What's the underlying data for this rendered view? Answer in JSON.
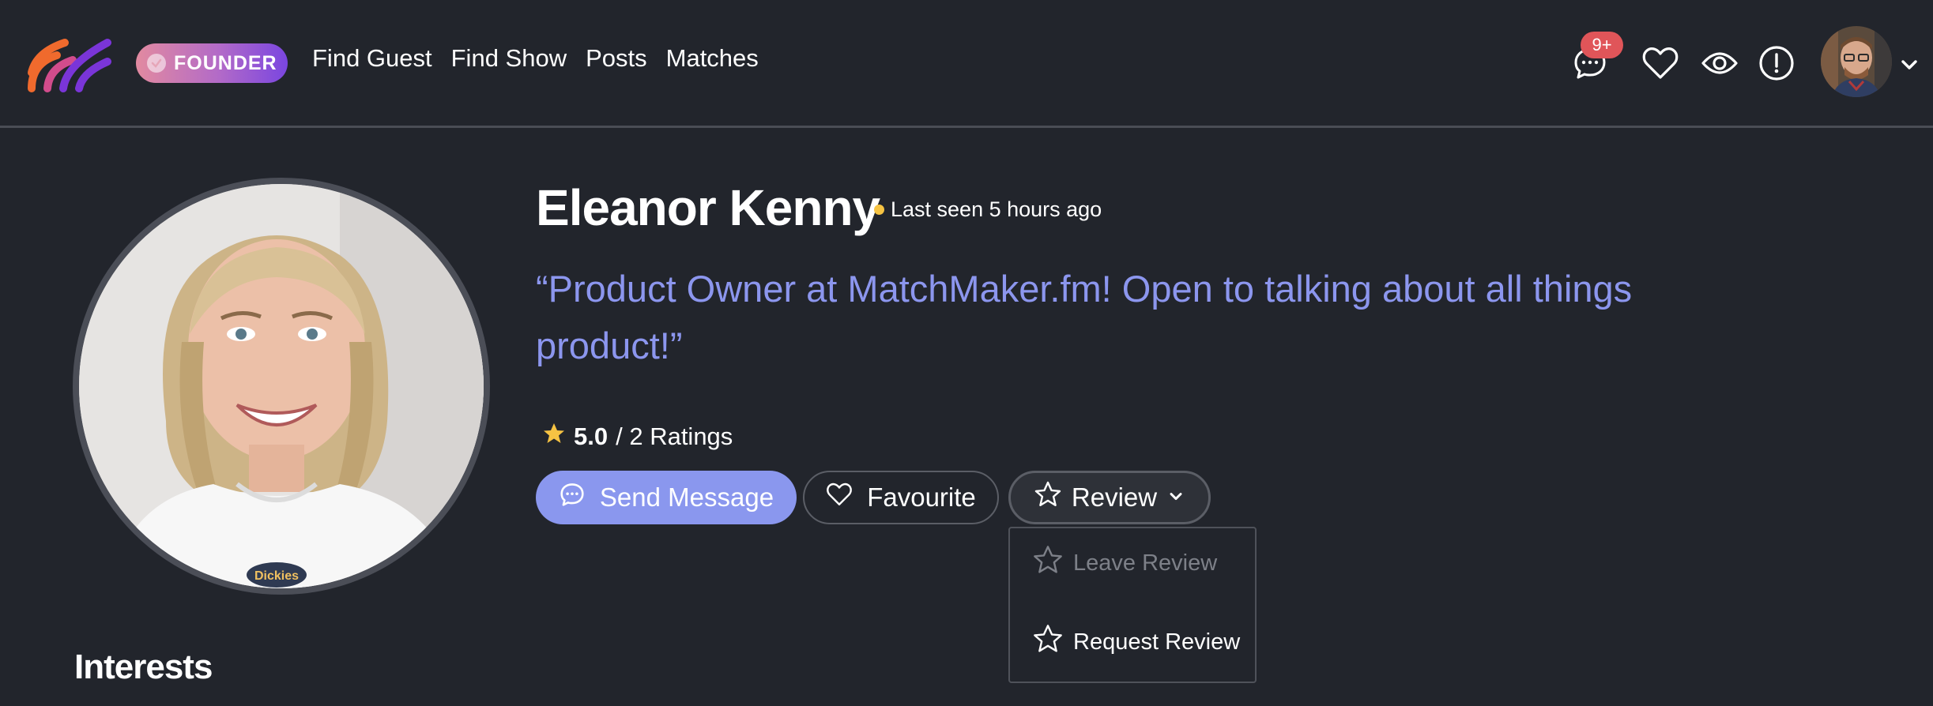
{
  "nav": {
    "badge_label": "FOUNDER",
    "links": [
      "Find Guest",
      "Find Show",
      "Posts",
      "Matches"
    ],
    "notification_count": "9+"
  },
  "profile": {
    "name": "Eleanor Kenny",
    "last_seen": "Last seen 5 hours ago",
    "headline": "“Product Owner at MatchMaker.fm! Open to talking about all things product!”",
    "rating_score": "5.0",
    "rating_count": "/ 2 Ratings",
    "photo_badge_text": "Dickies"
  },
  "actions": {
    "send_message": "Send Message",
    "favourite": "Favourite",
    "review": "Review"
  },
  "review_menu": {
    "items": [
      "Leave Review",
      "Request Review"
    ]
  },
  "sections": {
    "interests_heading": "Interests"
  },
  "colors": {
    "background": "#22252c",
    "accent": "#8a97ee",
    "headline": "#8c96ee",
    "star": "#f6c343",
    "badge_red": "#e05559",
    "logo_orange": "#f06a2d",
    "logo_purple": "#7a35d8"
  },
  "icons": [
    "logo-icon",
    "check-icon",
    "chat-icon",
    "heart-icon",
    "eye-icon",
    "alert-icon",
    "chevron-down-icon",
    "star-icon"
  ]
}
